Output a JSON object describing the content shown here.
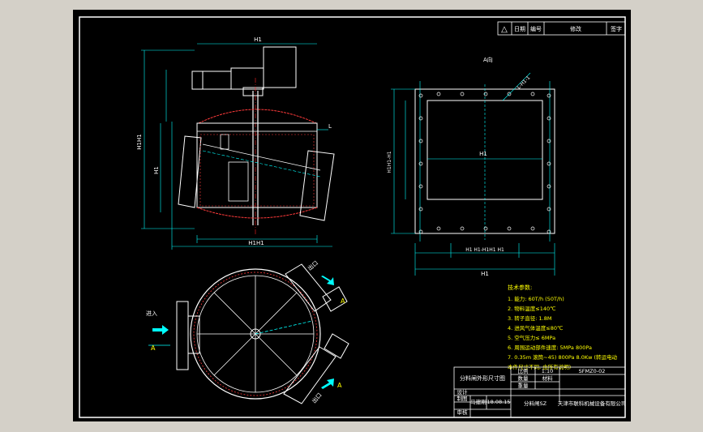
{
  "revision_table": {
    "mark_symbol": "△",
    "col_date": "日期",
    "col_no": "编号",
    "col_content": "修改",
    "col_sign": "签字"
  },
  "top_view": {
    "dim_top": "H1",
    "dim_bottom": "H1H1",
    "dim_left": "H1H1",
    "dim_inner": "H1",
    "dim_side": "L"
  },
  "plan_view": {
    "inlet_label": "进入",
    "outlet_label": "出口",
    "outlet_label_2": "出口",
    "arrow_a": "A",
    "arrow_a2": "A",
    "arrow_a3": "A"
  },
  "side_view": {
    "section_label": "A向",
    "dim_top": "H1",
    "dim_right_top": "L-H1-1",
    "dim_left": "H1H1-H1",
    "dim_bottom_segs": "H1  H1-H1H1  H1",
    "dim_bottom_total": "H1"
  },
  "technical_notes": {
    "title": "技术参数:",
    "lines": [
      "1. 能力: 60T/h  (50T/h)",
      "2. 物料温度≤140℃",
      "3. 转子直径: 1.8M",
      "4. 进风气体温度≤80℃",
      "5. 空气压力≤ 6MPa",
      "6. 周围运动部件速度: 5MPa  800Pa",
      "7. 0.35m  滚筒~45)  800Pa  8.0Kw (转运电动",
      "本件尺寸不同, 由所有说明)"
    ]
  },
  "title_block": {
    "drawing_name": "分料闸外形尺寸图",
    "scale_label": "比例",
    "scale_value": "1:10",
    "drawing_no": "SFMZ0-02",
    "row2_a": "数量",
    "row2_b": "材料",
    "row3_a": "重量",
    "draw_label": "制图",
    "design_label": "设计",
    "check_label": "审核",
    "drawer_name": "马建刚",
    "date": "18.08.15",
    "model": "分料闸SZ",
    "company": "天津市联科机械设备有限公司"
  },
  "colors": {
    "background": "#000000",
    "frame": "#ffffff",
    "outline": "#ffffff",
    "dimension": "#00ffff",
    "accent_red": "#ff3a3a",
    "centerline": "#ff2020",
    "notes": "#ffff00",
    "hidden": "#00ff00",
    "window_bg": "#d4d0c8"
  }
}
